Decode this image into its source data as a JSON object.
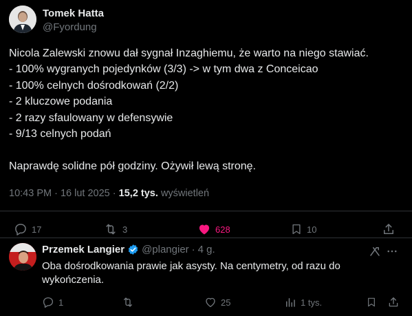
{
  "tweet": {
    "author": {
      "name": "Tomek Hatta",
      "handle": "@Fyordung"
    },
    "lines": [
      "Nicola Zalewski znowu dał sygnał Inzaghiemu, że warto na niego stawiać.",
      "- 100% wygranych pojedynków (3/3) -> w tym dwa z Conceicao",
      "- 100% celnych dośrodkowań (2/2)",
      "- 2 kluczowe podania",
      "- 2 razy sfaulowany w defensywie",
      "- 9/13 celnych podań",
      "",
      "Naprawdę solidne pół godziny. Ożywił lewą stronę."
    ],
    "time": "10:43 PM",
    "separator": "·",
    "date": "16 lut 2025",
    "views": "15,2 tys.",
    "views_label": "wyświetleń",
    "actions": {
      "replies": "17",
      "retweets": "3",
      "likes": "628",
      "bookmarks": "10"
    },
    "colors": {
      "like_active": "#f91880",
      "verified": "#1d9bf0"
    }
  },
  "reply": {
    "author": {
      "name": "Przemek Langier",
      "handle": "@plangier",
      "separator": "·",
      "time": "4 g."
    },
    "text": "Oba dośrodkowania prawie jak asysty. Na centymetry, od razu do wykończenia.",
    "actions": {
      "replies": "1",
      "retweets": "",
      "likes": "25",
      "views": "1 tys."
    }
  }
}
